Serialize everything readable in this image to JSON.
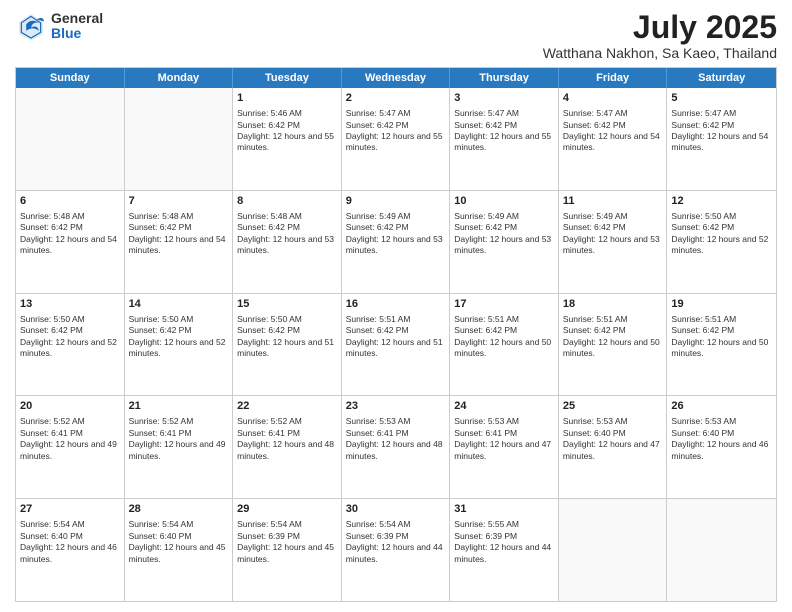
{
  "header": {
    "logo": {
      "general": "General",
      "blue": "Blue"
    },
    "title": "July 2025",
    "subtitle": "Watthana Nakhon, Sa Kaeo, Thailand"
  },
  "calendar": {
    "days": [
      "Sunday",
      "Monday",
      "Tuesday",
      "Wednesday",
      "Thursday",
      "Friday",
      "Saturday"
    ],
    "rows": [
      [
        {
          "day": "",
          "sunrise": "",
          "sunset": "",
          "daylight": "",
          "empty": true
        },
        {
          "day": "",
          "sunrise": "",
          "sunset": "",
          "daylight": "",
          "empty": true
        },
        {
          "day": "1",
          "sunrise": "Sunrise: 5:46 AM",
          "sunset": "Sunset: 6:42 PM",
          "daylight": "Daylight: 12 hours and 55 minutes."
        },
        {
          "day": "2",
          "sunrise": "Sunrise: 5:47 AM",
          "sunset": "Sunset: 6:42 PM",
          "daylight": "Daylight: 12 hours and 55 minutes."
        },
        {
          "day": "3",
          "sunrise": "Sunrise: 5:47 AM",
          "sunset": "Sunset: 6:42 PM",
          "daylight": "Daylight: 12 hours and 55 minutes."
        },
        {
          "day": "4",
          "sunrise": "Sunrise: 5:47 AM",
          "sunset": "Sunset: 6:42 PM",
          "daylight": "Daylight: 12 hours and 54 minutes."
        },
        {
          "day": "5",
          "sunrise": "Sunrise: 5:47 AM",
          "sunset": "Sunset: 6:42 PM",
          "daylight": "Daylight: 12 hours and 54 minutes."
        }
      ],
      [
        {
          "day": "6",
          "sunrise": "Sunrise: 5:48 AM",
          "sunset": "Sunset: 6:42 PM",
          "daylight": "Daylight: 12 hours and 54 minutes."
        },
        {
          "day": "7",
          "sunrise": "Sunrise: 5:48 AM",
          "sunset": "Sunset: 6:42 PM",
          "daylight": "Daylight: 12 hours and 54 minutes."
        },
        {
          "day": "8",
          "sunrise": "Sunrise: 5:48 AM",
          "sunset": "Sunset: 6:42 PM",
          "daylight": "Daylight: 12 hours and 53 minutes."
        },
        {
          "day": "9",
          "sunrise": "Sunrise: 5:49 AM",
          "sunset": "Sunset: 6:42 PM",
          "daylight": "Daylight: 12 hours and 53 minutes."
        },
        {
          "day": "10",
          "sunrise": "Sunrise: 5:49 AM",
          "sunset": "Sunset: 6:42 PM",
          "daylight": "Daylight: 12 hours and 53 minutes."
        },
        {
          "day": "11",
          "sunrise": "Sunrise: 5:49 AM",
          "sunset": "Sunset: 6:42 PM",
          "daylight": "Daylight: 12 hours and 53 minutes."
        },
        {
          "day": "12",
          "sunrise": "Sunrise: 5:50 AM",
          "sunset": "Sunset: 6:42 PM",
          "daylight": "Daylight: 12 hours and 52 minutes."
        }
      ],
      [
        {
          "day": "13",
          "sunrise": "Sunrise: 5:50 AM",
          "sunset": "Sunset: 6:42 PM",
          "daylight": "Daylight: 12 hours and 52 minutes."
        },
        {
          "day": "14",
          "sunrise": "Sunrise: 5:50 AM",
          "sunset": "Sunset: 6:42 PM",
          "daylight": "Daylight: 12 hours and 52 minutes."
        },
        {
          "day": "15",
          "sunrise": "Sunrise: 5:50 AM",
          "sunset": "Sunset: 6:42 PM",
          "daylight": "Daylight: 12 hours and 51 minutes."
        },
        {
          "day": "16",
          "sunrise": "Sunrise: 5:51 AM",
          "sunset": "Sunset: 6:42 PM",
          "daylight": "Daylight: 12 hours and 51 minutes."
        },
        {
          "day": "17",
          "sunrise": "Sunrise: 5:51 AM",
          "sunset": "Sunset: 6:42 PM",
          "daylight": "Daylight: 12 hours and 50 minutes."
        },
        {
          "day": "18",
          "sunrise": "Sunrise: 5:51 AM",
          "sunset": "Sunset: 6:42 PM",
          "daylight": "Daylight: 12 hours and 50 minutes."
        },
        {
          "day": "19",
          "sunrise": "Sunrise: 5:51 AM",
          "sunset": "Sunset: 6:42 PM",
          "daylight": "Daylight: 12 hours and 50 minutes."
        }
      ],
      [
        {
          "day": "20",
          "sunrise": "Sunrise: 5:52 AM",
          "sunset": "Sunset: 6:41 PM",
          "daylight": "Daylight: 12 hours and 49 minutes."
        },
        {
          "day": "21",
          "sunrise": "Sunrise: 5:52 AM",
          "sunset": "Sunset: 6:41 PM",
          "daylight": "Daylight: 12 hours and 49 minutes."
        },
        {
          "day": "22",
          "sunrise": "Sunrise: 5:52 AM",
          "sunset": "Sunset: 6:41 PM",
          "daylight": "Daylight: 12 hours and 48 minutes."
        },
        {
          "day": "23",
          "sunrise": "Sunrise: 5:53 AM",
          "sunset": "Sunset: 6:41 PM",
          "daylight": "Daylight: 12 hours and 48 minutes."
        },
        {
          "day": "24",
          "sunrise": "Sunrise: 5:53 AM",
          "sunset": "Sunset: 6:41 PM",
          "daylight": "Daylight: 12 hours and 47 minutes."
        },
        {
          "day": "25",
          "sunrise": "Sunrise: 5:53 AM",
          "sunset": "Sunset: 6:40 PM",
          "daylight": "Daylight: 12 hours and 47 minutes."
        },
        {
          "day": "26",
          "sunrise": "Sunrise: 5:53 AM",
          "sunset": "Sunset: 6:40 PM",
          "daylight": "Daylight: 12 hours and 46 minutes."
        }
      ],
      [
        {
          "day": "27",
          "sunrise": "Sunrise: 5:54 AM",
          "sunset": "Sunset: 6:40 PM",
          "daylight": "Daylight: 12 hours and 46 minutes."
        },
        {
          "day": "28",
          "sunrise": "Sunrise: 5:54 AM",
          "sunset": "Sunset: 6:40 PM",
          "daylight": "Daylight: 12 hours and 45 minutes."
        },
        {
          "day": "29",
          "sunrise": "Sunrise: 5:54 AM",
          "sunset": "Sunset: 6:39 PM",
          "daylight": "Daylight: 12 hours and 45 minutes."
        },
        {
          "day": "30",
          "sunrise": "Sunrise: 5:54 AM",
          "sunset": "Sunset: 6:39 PM",
          "daylight": "Daylight: 12 hours and 44 minutes."
        },
        {
          "day": "31",
          "sunrise": "Sunrise: 5:55 AM",
          "sunset": "Sunset: 6:39 PM",
          "daylight": "Daylight: 12 hours and 44 minutes."
        },
        {
          "day": "",
          "sunrise": "",
          "sunset": "",
          "daylight": "",
          "empty": true
        },
        {
          "day": "",
          "sunrise": "",
          "sunset": "",
          "daylight": "",
          "empty": true
        }
      ]
    ]
  }
}
